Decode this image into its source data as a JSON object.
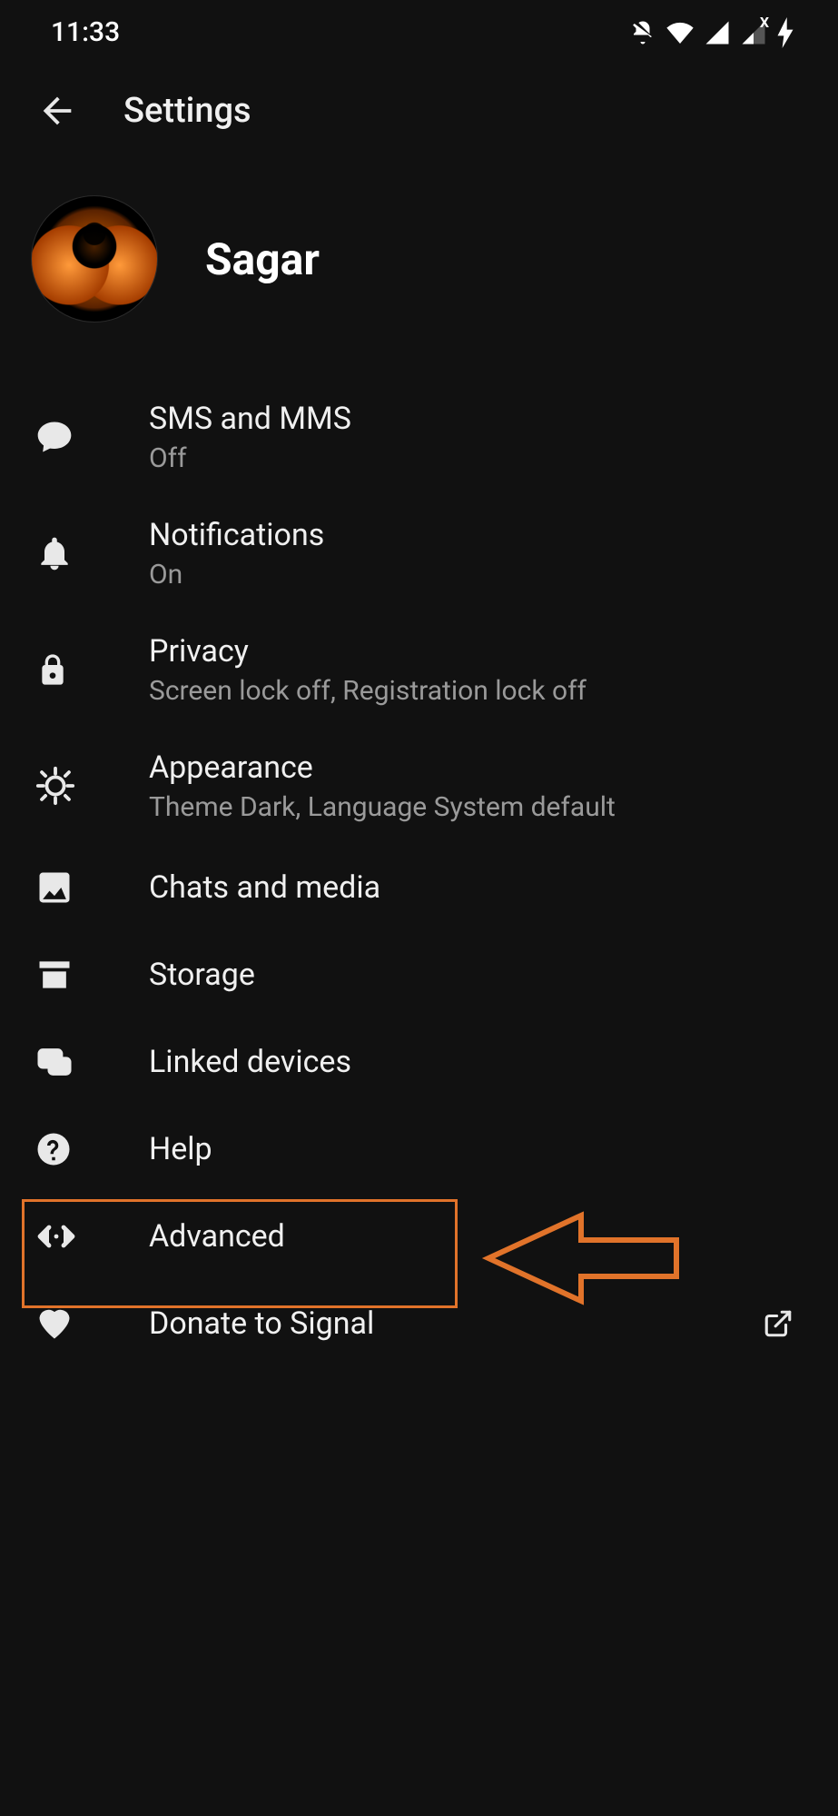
{
  "status": {
    "time": "11:33"
  },
  "header": {
    "title": "Settings"
  },
  "profile": {
    "name": "Sagar"
  },
  "items": {
    "sms": {
      "title": "SMS and MMS",
      "subtitle": "Off"
    },
    "notif": {
      "title": "Notifications",
      "subtitle": "On"
    },
    "privacy": {
      "title": "Privacy",
      "subtitle": "Screen lock off, Registration lock off"
    },
    "appearance": {
      "title": "Appearance",
      "subtitle": "Theme Dark, Language System default"
    },
    "chats": {
      "title": "Chats and media"
    },
    "storage": {
      "title": "Storage"
    },
    "linked": {
      "title": "Linked devices"
    },
    "help": {
      "title": "Help"
    },
    "advanced": {
      "title": "Advanced"
    },
    "donate": {
      "title": "Donate to Signal"
    }
  }
}
